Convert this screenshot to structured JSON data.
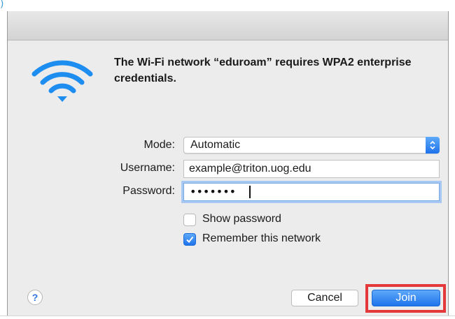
{
  "top_glyph": ")",
  "dialog": {
    "heading": "The Wi-Fi network “eduroam” requires WPA2 enterprise credentials.",
    "mode": {
      "label": "Mode:",
      "value": "Automatic"
    },
    "username": {
      "label": "Username:",
      "value": "example@triton.uog.edu"
    },
    "password": {
      "label": "Password:",
      "masked_value": "•••••••"
    },
    "show_password": {
      "label": "Show password",
      "checked": false
    },
    "remember_network": {
      "label": "Remember this network",
      "checked": true
    },
    "help_label": "?",
    "cancel_label": "Cancel",
    "join_label": "Join"
  },
  "colors": {
    "accent_blue": "#2f8bff",
    "highlight_red": "#e5383b",
    "wifi_blue": "#1e8df0"
  },
  "icons": {
    "wifi": "wifi-icon",
    "stepper": "chevron-updown-icon",
    "check": "checkmark-icon"
  }
}
